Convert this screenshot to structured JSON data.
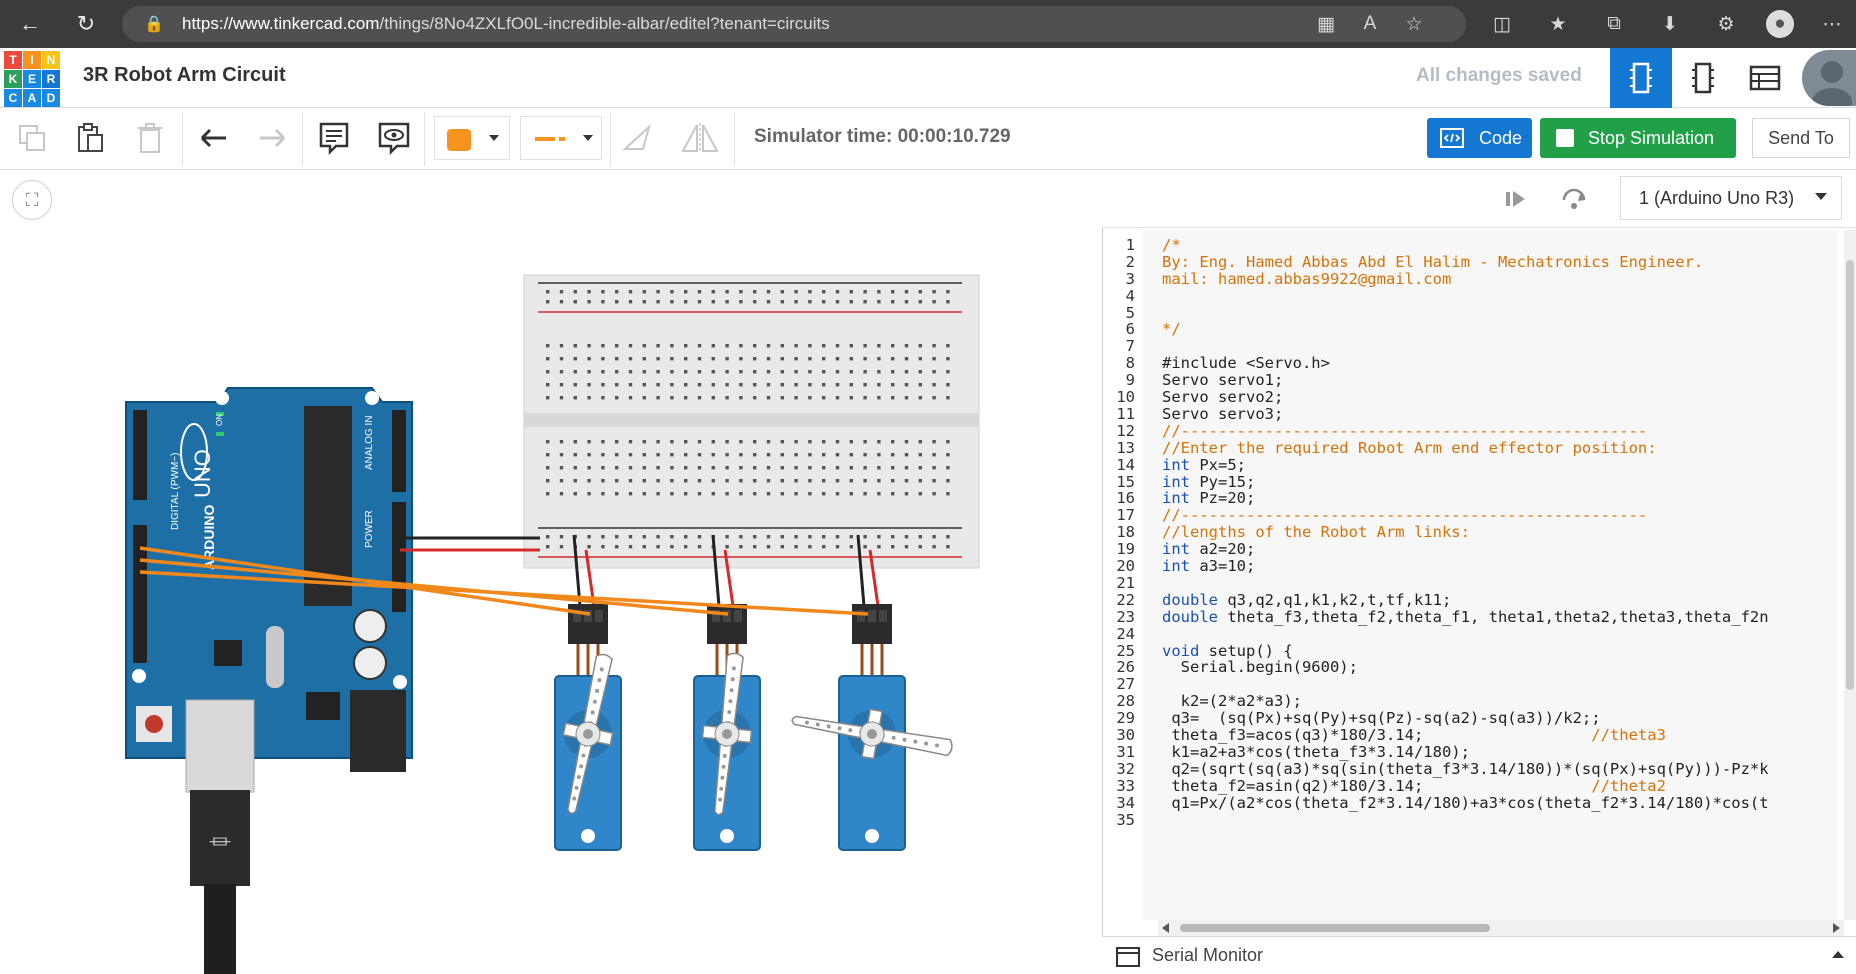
{
  "browser": {
    "url_host": "https://www.tinkercad.com",
    "url_path": "/things/8No4ZXLfO0L-incredible-albar/editel?tenant=circuits"
  },
  "header": {
    "logo_letters": [
      "T",
      "I",
      "N",
      "K",
      "E",
      "R",
      "C",
      "A",
      "D"
    ],
    "title": "3R Robot Arm Circuit",
    "save_status": "All changes saved"
  },
  "toolbar": {
    "sim_time": "Simulator time: 00:00:10.729",
    "code_label": "Code",
    "stop_label": "Stop Simulation",
    "send_label": "Send To",
    "color_swatch": "#f7931e"
  },
  "code_panel": {
    "device_select": "1 (Arduino Uno R3)",
    "serial_monitor": "Serial Monitor",
    "lines": [
      "/*",
      "By: Eng. Hamed Abbas Abd El Halim - Mechatronics Engineer.",
      "mail: hamed.abbas9922@gmail.com",
      "",
      "",
      "*/",
      "",
      "#include <Servo.h>",
      "Servo servo1;",
      "Servo servo2;",
      "Servo servo3;",
      "//--------------------------------------------------",
      "//Enter the required Robot Arm end effector position:",
      "int Px=5;",
      "int Py=15;",
      "int Pz=20;",
      "//--------------------------------------------------",
      "//lengths of the Robot Arm links:",
      "int a2=20;",
      "int a3=10;",
      "",
      "double q3,q2,q1,k1,k2,t,tf,k11;",
      "double theta_f3,theta_f2,theta_f1, theta1,theta2,theta3,theta_f2n",
      "",
      "void setup() {",
      "  Serial.begin(9600);",
      "",
      "  k2=(2*a2*a3);",
      " q3=  (sq(Px)+sq(Py)+sq(Pz)-sq(a2)-sq(a3))/k2;;",
      " theta_f3=acos(q3)*180/3.14;                  //theta3",
      " k1=a2+a3*cos(theta_f3*3.14/180);",
      " q2=(sqrt(sq(a3)*sq(sin(theta_f3*3.14/180))*(sq(Px)+sq(Py)))-Pz*k",
      " theta_f2=asin(q2)*180/3.14;                  //theta2",
      " q1=Px/(a2*cos(theta_f2*3.14/180)+a3*cos(theta_f2*3.14/180)*cos(t",
      ""
    ]
  },
  "circuit": {
    "board_label": "ARDUINO",
    "board_model": "UNO",
    "power_label": "POWER",
    "analog_label": "ANALOG IN",
    "digital_label": "DIGITAL (PWM~)",
    "on_label": "ON"
  }
}
